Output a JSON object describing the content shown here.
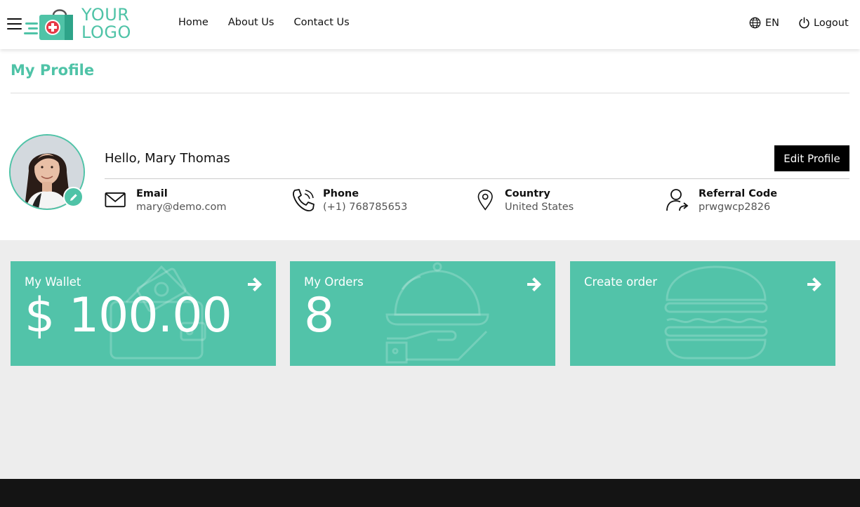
{
  "header": {
    "logo_line1": "YOUR",
    "logo_line2": "LOGO",
    "nav": [
      {
        "label": "Home"
      },
      {
        "label": "About Us"
      },
      {
        "label": "Contact Us"
      }
    ],
    "language": "EN",
    "logout_label": "Logout"
  },
  "profile": {
    "page_title": "My Profile",
    "greeting": "Hello, Mary Thomas",
    "edit_label": "Edit Profile",
    "email_label": "Email",
    "email_value": "mary@demo.com",
    "phone_label": "Phone",
    "phone_value": "(+1) 768785653",
    "country_label": "Country",
    "country_value": "United States",
    "referral_label": "Referral Code",
    "referral_value": "prwgwcp2826"
  },
  "cards": {
    "wallet_title": "My Wallet",
    "wallet_value": "$ 100.00",
    "orders_title": "My Orders",
    "orders_value": "8",
    "create_title": "Create order"
  },
  "colors": {
    "accent": "#4fc3a7",
    "card": "#52c3a9",
    "footer": "#141414"
  }
}
